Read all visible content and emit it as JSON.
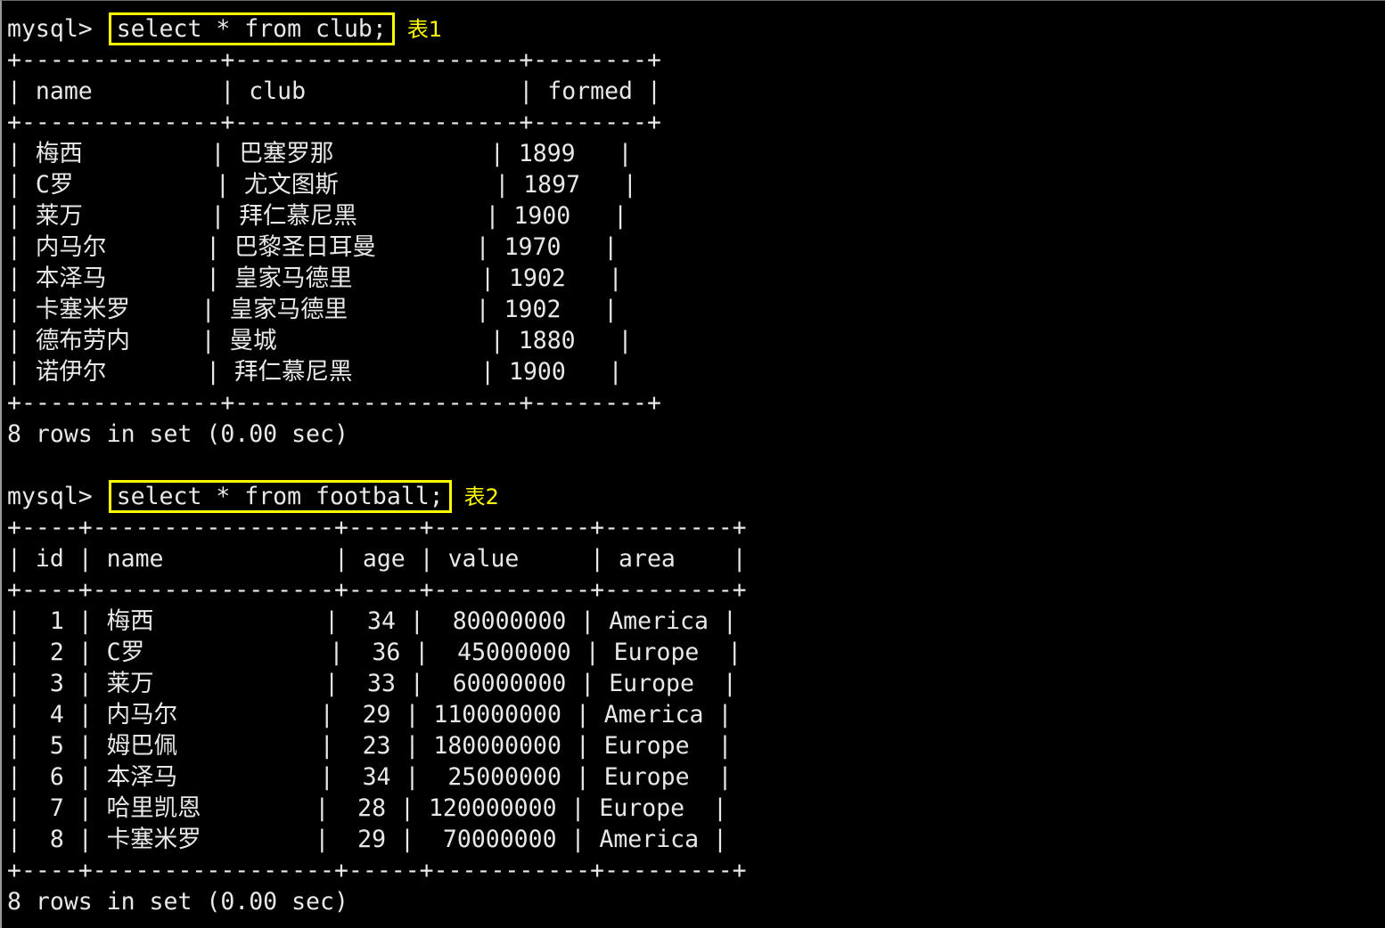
{
  "terminal": {
    "background_color": "#000000",
    "text_color": "#e8e8e8",
    "annotation_color": "#ffff00",
    "prompt": "mysql> "
  },
  "queries": [
    {
      "prompt": "mysql> ",
      "sql": "select * from club;",
      "annotation": "表1",
      "status": "8 rows in set (0.00 sec)",
      "separator": "+--------------+--------------------+--------+",
      "header": "| name         | club               | formed |",
      "columns": [
        "name",
        "club",
        "formed"
      ],
      "rows": [
        {
          "name": "梅西",
          "club": "巴塞罗那",
          "formed": "1899"
        },
        {
          "name": "C罗",
          "club": "尤文图斯",
          "formed": "1897"
        },
        {
          "name": "莱万",
          "club": "拜仁慕尼黑",
          "formed": "1900"
        },
        {
          "name": "内马尔",
          "club": "巴黎圣日耳曼",
          "formed": "1970"
        },
        {
          "name": "本泽马",
          "club": "皇家马德里",
          "formed": "1902"
        },
        {
          "name": "卡塞米罗",
          "club": "皇家马德里",
          "formed": "1902"
        },
        {
          "name": "德布劳内",
          "club": "曼城",
          "formed": "1880"
        },
        {
          "name": "诺伊尔",
          "club": "拜仁慕尼黑",
          "formed": "1900"
        }
      ],
      "row_lines": [
        "| 梅西         | 巴塞罗那           | 1899   |",
        "| C罗          | 尤文图斯           | 1897   |",
        "| 莱万         | 拜仁慕尼黑         | 1900   |",
        "| 内马尔       | 巴黎圣日耳曼       | 1970   |",
        "| 本泽马       | 皇家马德里         | 1902   |",
        "| 卡塞米罗     | 皇家马德里         | 1902   |",
        "| 德布劳内     | 曼城               | 1880   |",
        "| 诺伊尔       | 拜仁慕尼黑         | 1900   |"
      ]
    },
    {
      "prompt": "mysql> ",
      "sql": "select * from football;",
      "annotation": "表2",
      "status": "8 rows in set (0.00 sec)",
      "separator": "+----+-----------------+-----+-----------+---------+",
      "header": "| id | name            | age | value     | area    |",
      "columns": [
        "id",
        "name",
        "age",
        "value",
        "area"
      ],
      "rows": [
        {
          "id": "1",
          "name": "梅西",
          "age": "34",
          "value": "80000000",
          "area": "America"
        },
        {
          "id": "2",
          "name": "C罗",
          "age": "36",
          "value": "45000000",
          "area": "Europe"
        },
        {
          "id": "3",
          "name": "莱万",
          "age": "33",
          "value": "60000000",
          "area": "Europe"
        },
        {
          "id": "4",
          "name": "内马尔",
          "age": "29",
          "value": "110000000",
          "area": "America"
        },
        {
          "id": "5",
          "name": "姆巴佩",
          "age": "23",
          "value": "180000000",
          "area": "Europe"
        },
        {
          "id": "6",
          "name": "本泽马",
          "age": "34",
          "value": "25000000",
          "area": "Europe"
        },
        {
          "id": "7",
          "name": "哈里凯恩",
          "age": "28",
          "value": "120000000",
          "area": "Europe"
        },
        {
          "id": "8",
          "name": "卡塞米罗",
          "age": "29",
          "value": "70000000",
          "area": "America"
        }
      ],
      "row_lines": [
        "|  1 | 梅西            |  34 |  80000000 | America |",
        "|  2 | C罗             |  36 |  45000000 | Europe  |",
        "|  3 | 莱万            |  33 |  60000000 | Europe  |",
        "|  4 | 内马尔          |  29 | 110000000 | America |",
        "|  5 | 姆巴佩          |  23 | 180000000 | Europe  |",
        "|  6 | 本泽马          |  34 |  25000000 | Europe  |",
        "|  7 | 哈里凯恩        |  28 | 120000000 | Europe  |",
        "|  8 | 卡塞米罗        |  29 |  70000000 | America |"
      ]
    }
  ]
}
